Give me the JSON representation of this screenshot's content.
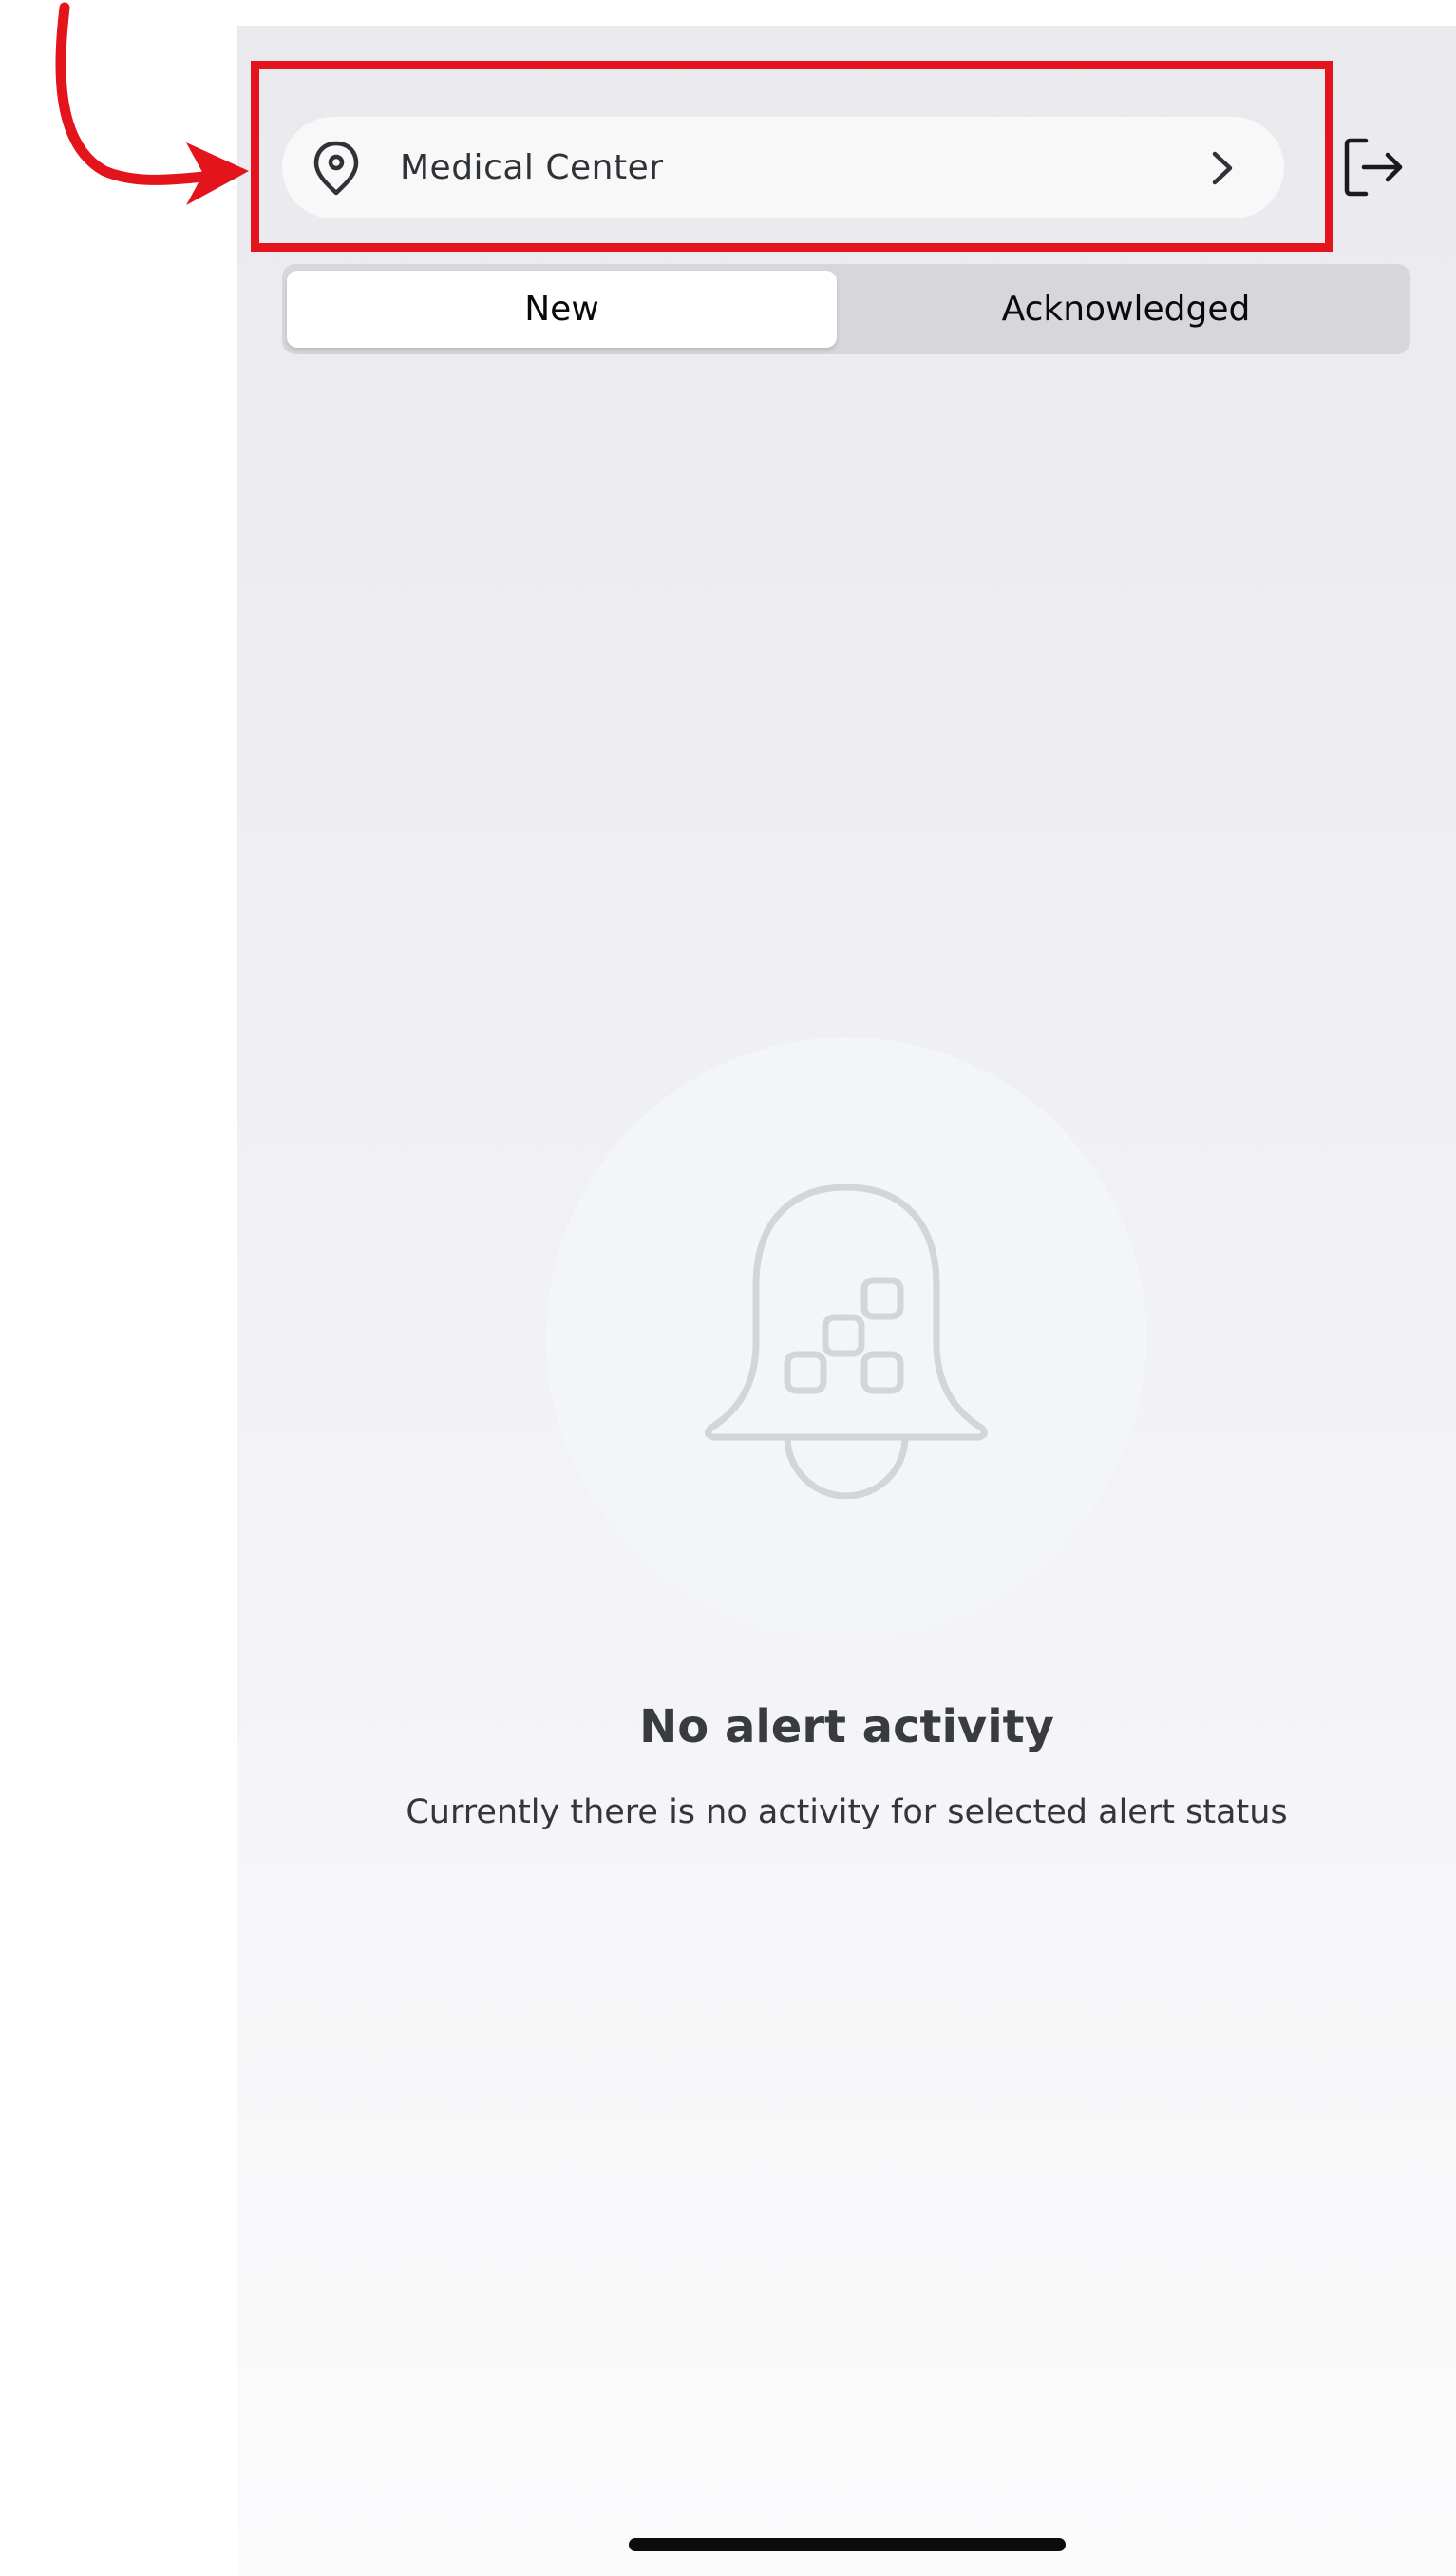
{
  "header": {
    "location_label": "Medical Center",
    "location_icon": "map-pin-icon",
    "chevron_icon": "chevron-right-icon",
    "logout_icon": "logout-icon"
  },
  "tabs": [
    {
      "label": "New",
      "selected": true
    },
    {
      "label": "Acknowledged",
      "selected": false
    }
  ],
  "empty_state": {
    "icon": "bell-icon",
    "title": "No alert activity",
    "subtitle": "Currently there is no activity for selected alert status"
  },
  "annotation": {
    "color": "#e3141b"
  },
  "colors": {
    "background": "#eeedf1",
    "pill": "#f8f8f9",
    "segment_track": "#d6d6db",
    "icon_gray": "#d3d5d7",
    "text_dark": "#383b40"
  }
}
